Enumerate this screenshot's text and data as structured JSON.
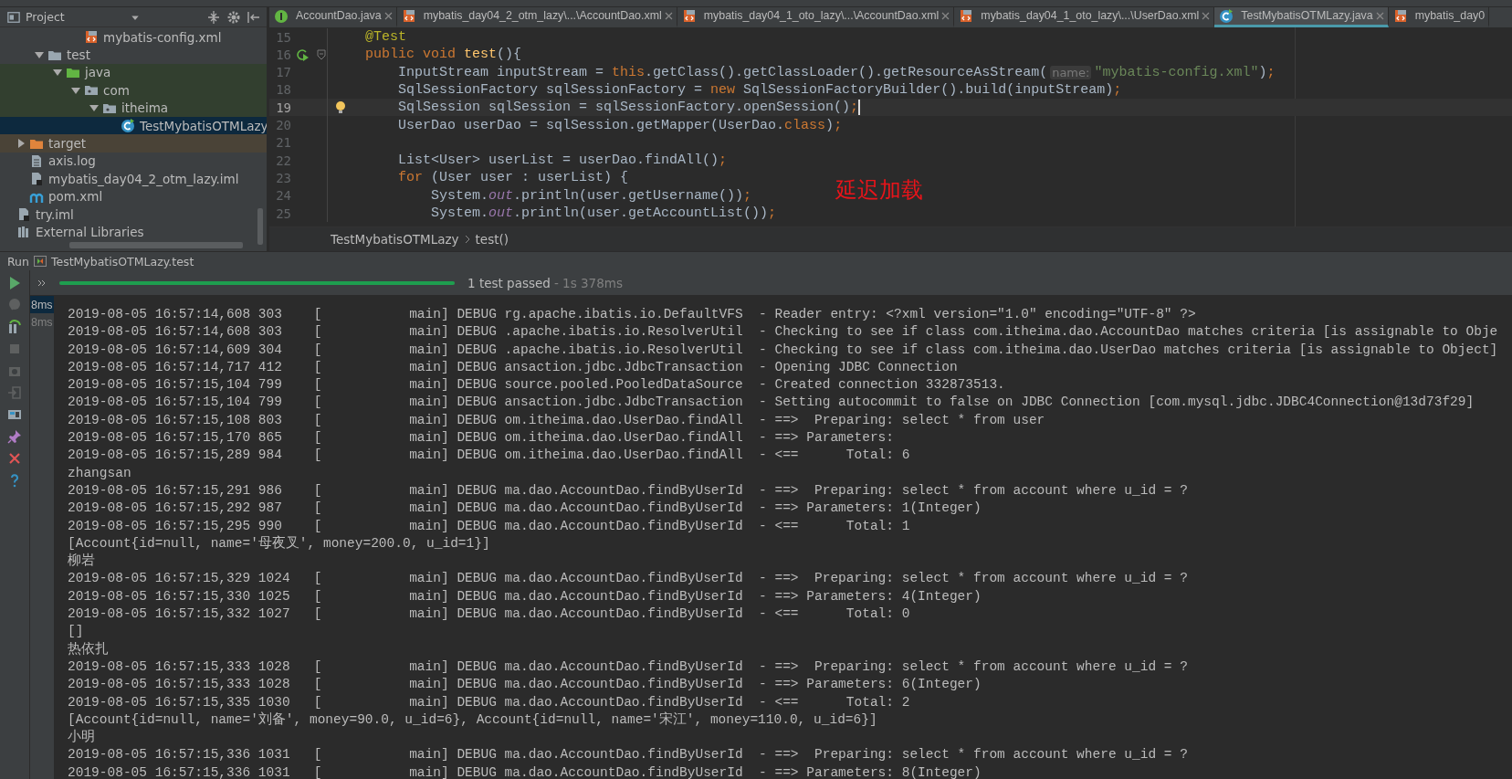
{
  "project_panel": {
    "title": "Project",
    "tree": [
      {
        "children": [
          {
            "children": [
              {
                "children": [
                  {
                    "children": [
                      {
                        "label": "mybatis-config.xml",
                        "kind": "xml",
                        "selected": false
                      }
                    ]
                  }
                ]
              },
              {
                "label": "test",
                "kind": "folder",
                "expanded": true,
                "selected": false,
                "children": [
                  {
                    "label": "java",
                    "kind": "test-root",
                    "expanded": true,
                    "selected": false,
                    "children": [
                      {
                        "label": "com",
                        "kind": "package",
                        "expanded": true,
                        "selected": false,
                        "children": [
                          {
                            "label": "itheima",
                            "kind": "package",
                            "expanded": true,
                            "selected": false,
                            "children": [
                              {
                                "label": "TestMybatisOTMLazy",
                                "kind": "test-class",
                                "selected": true
                              }
                            ]
                          }
                        ]
                      }
                    ]
                  }
                ]
              }
            ]
          },
          {
            "label": "target",
            "kind": "excluded",
            "expanded": false,
            "selected": false
          },
          {
            "label": "axis.log",
            "kind": "file",
            "selected": false
          },
          {
            "label": "mybatis_day04_2_otm_lazy.iml",
            "kind": "iml",
            "selected": false
          },
          {
            "label": "pom.xml",
            "kind": "maven",
            "selected": false
          }
        ]
      },
      {
        "label": "try.iml",
        "kind": "iml",
        "selected": false
      },
      {
        "label": "External Libraries",
        "kind": "libraries",
        "selected": false
      }
    ]
  },
  "editor": {
    "tabs": [
      {
        "label": "AccountDao.java",
        "kind": "interface",
        "selected": false,
        "closable": true
      },
      {
        "label": "mybatis_day04_2_otm_lazy\\...\\AccountDao.xml",
        "kind": "xml",
        "selected": false,
        "closable": true
      },
      {
        "label": "mybatis_day04_1_oto_lazy\\...\\AccountDao.xml",
        "kind": "xml",
        "selected": false,
        "closable": true
      },
      {
        "label": "mybatis_day04_1_oto_lazy\\...\\UserDao.xml",
        "kind": "xml",
        "selected": false,
        "closable": true
      },
      {
        "label": "TestMybatisOTMLazy.java",
        "kind": "test-class",
        "selected": true,
        "closable": true
      },
      {
        "label": "mybatis_day0",
        "kind": "xml",
        "selected": false
      }
    ],
    "lines": [
      {
        "number": "15",
        "kind": "plain",
        "current": false,
        "tokens": [
          {
            "kind": "annotation",
            "text": "    @Test"
          }
        ]
      },
      {
        "number": "16",
        "kind": "run",
        "current": false,
        "tokens": [
          {
            "kind": "keyword",
            "text": "    public void "
          },
          {
            "kind": "method",
            "text": "test"
          },
          {
            "kind": "plain",
            "text": "(){"
          }
        ]
      },
      {
        "number": "17",
        "kind": "plain",
        "current": false,
        "tokens": [
          {
            "kind": "plain",
            "text": "        InputStream inputStream = "
          },
          {
            "kind": "keyword",
            "text": "this"
          },
          {
            "kind": "plain",
            "text": ".getClass().getClassLoader().getResourceAsStream("
          },
          {
            "kind": "hint",
            "text": "name:"
          },
          {
            "kind": "string",
            "text": "\"mybatis-config.xml\""
          },
          {
            "kind": "plain",
            "text": ")"
          },
          {
            "kind": "keyword",
            "text": ";"
          }
        ]
      },
      {
        "number": "18",
        "kind": "plain",
        "current": false,
        "tokens": [
          {
            "kind": "plain",
            "text": "        SqlSessionFactory sqlSessionFactory = "
          },
          {
            "kind": "keyword",
            "text": "new"
          },
          {
            "kind": "plain",
            "text": " SqlSessionFactoryBuilder().build(inputStream)"
          },
          {
            "kind": "keyword",
            "text": ";"
          }
        ]
      },
      {
        "number": "19",
        "kind": "bulb",
        "current": true,
        "tokens": [
          {
            "kind": "plain",
            "text": "        SqlSession sqlSession = sqlSessionFactory.openSession()"
          },
          {
            "kind": "keyword",
            "text": ";"
          }
        ]
      },
      {
        "number": "20",
        "kind": "plain",
        "current": false,
        "tokens": [
          {
            "kind": "plain",
            "text": "        UserDao userDao = sqlSession.getMapper(UserDao."
          },
          {
            "kind": "keyword",
            "text": "class"
          },
          {
            "kind": "plain",
            "text": ")"
          },
          {
            "kind": "keyword",
            "text": ";"
          }
        ]
      },
      {
        "number": "21",
        "kind": "plain",
        "current": false
      },
      {
        "number": "22",
        "kind": "plain",
        "current": false,
        "tokens": [
          {
            "kind": "plain",
            "text": "        List<User> userList = userDao.findAll()"
          },
          {
            "kind": "keyword",
            "text": ";"
          }
        ]
      },
      {
        "number": "23",
        "kind": "plain",
        "current": false,
        "tokens": [
          {
            "kind": "keyword",
            "text": "        for"
          },
          {
            "kind": "plain",
            "text": " (User user : userList) {"
          }
        ]
      },
      {
        "number": "24",
        "kind": "plain",
        "current": false,
        "tokens": [
          {
            "kind": "plain",
            "text": "            System."
          },
          {
            "kind": "static",
            "text": "out"
          },
          {
            "kind": "plain",
            "text": ".println(user.getUsername())"
          },
          {
            "kind": "keyword",
            "text": ";"
          }
        ]
      },
      {
        "number": "25",
        "kind": "plain",
        "current": false,
        "tokens": [
          {
            "kind": "plain",
            "text": "            System."
          },
          {
            "kind": "static",
            "text": "out"
          },
          {
            "kind": "plain",
            "text": ".println(user.getAccountList())"
          },
          {
            "kind": "keyword",
            "text": ";"
          }
        ]
      }
    ],
    "annotation": "延迟加载",
    "breadcrumb": [
      "TestMybatisOTMLazy",
      "test()"
    ]
  },
  "run_panel": {
    "label": "Run",
    "config": "TestMybatisOTMLazy.test",
    "progress": {
      "level": 1
    },
    "status": "1 test passed",
    "duration": "- 1s 378ms",
    "tests": [
      {
        "duration": "8ms",
        "selected": true
      },
      {
        "duration": "8ms",
        "selected": false
      }
    ],
    "console": [
      {
        "kind": "log",
        "time": "2019-08-05 16:57:14,608 303",
        "thread": "[           main]",
        "level": "DEBUG",
        "logger": "rg.apache.ibatis.io.DefaultVFS",
        "message": "- Reader entry: <?xml version=\"1.0\" encoding=\"UTF-8\" ?>"
      },
      {
        "kind": "log",
        "time": "2019-08-05 16:57:14,608 303",
        "thread": "[           main]",
        "level": "DEBUG",
        "logger": ".apache.ibatis.io.ResolverUtil",
        "message": "- Checking to see if class com.itheima.dao.AccountDao matches criteria [is assignable to Obje"
      },
      {
        "kind": "log",
        "time": "2019-08-05 16:57:14,609 304",
        "thread": "[           main]",
        "level": "DEBUG",
        "logger": ".apache.ibatis.io.ResolverUtil",
        "message": "- Checking to see if class com.itheima.dao.UserDao matches criteria [is assignable to Object]"
      },
      {
        "kind": "log",
        "time": "2019-08-05 16:57:14,717 412",
        "thread": "[           main]",
        "level": "DEBUG",
        "logger": "ansaction.jdbc.JdbcTransaction",
        "message": "- Opening JDBC Connection"
      },
      {
        "kind": "log",
        "time": "2019-08-05 16:57:15,104 799",
        "thread": "[           main]",
        "level": "DEBUG",
        "logger": "source.pooled.PooledDataSource",
        "message": "- Created connection 332873513."
      },
      {
        "kind": "log",
        "time": "2019-08-05 16:57:15,104 799",
        "thread": "[           main]",
        "level": "DEBUG",
        "logger": "ansaction.jdbc.JdbcTransaction",
        "message": "- Setting autocommit to false on JDBC Connection [com.mysql.jdbc.JDBC4Connection@13d73f29]"
      },
      {
        "kind": "log",
        "time": "2019-08-05 16:57:15,108 803",
        "thread": "[           main]",
        "level": "DEBUG",
        "logger": "om.itheima.dao.UserDao.findAll",
        "message": "- ==>  Preparing: select * from user"
      },
      {
        "kind": "log",
        "time": "2019-08-05 16:57:15,170 865",
        "thread": "[           main]",
        "level": "DEBUG",
        "logger": "om.itheima.dao.UserDao.findAll",
        "message": "- ==> Parameters:"
      },
      {
        "kind": "log",
        "time": "2019-08-05 16:57:15,289 984",
        "thread": "[           main]",
        "level": "DEBUG",
        "logger": "om.itheima.dao.UserDao.findAll",
        "message": "- <==      Total: 6"
      },
      {
        "kind": "out",
        "text": "zhangsan"
      },
      {
        "kind": "log",
        "time": "2019-08-05 16:57:15,291 986",
        "thread": "[           main]",
        "level": "DEBUG",
        "logger": "ma.dao.AccountDao.findByUserId",
        "message": "- ==>  Preparing: select * from account where u_id = ?"
      },
      {
        "kind": "log",
        "time": "2019-08-05 16:57:15,292 987",
        "thread": "[           main]",
        "level": "DEBUG",
        "logger": "ma.dao.AccountDao.findByUserId",
        "message": "- ==> Parameters: 1(Integer)"
      },
      {
        "kind": "log",
        "time": "2019-08-05 16:57:15,295 990",
        "thread": "[           main]",
        "level": "DEBUG",
        "logger": "ma.dao.AccountDao.findByUserId",
        "message": "- <==      Total: 1"
      },
      {
        "kind": "out",
        "text": "[Account{id=null, name='母夜叉', money=200.0, u_id=1}]"
      },
      {
        "kind": "out",
        "text": "柳岩"
      },
      {
        "kind": "log",
        "time": "2019-08-05 16:57:15,329 1024",
        "thread": "[           main]",
        "level": "DEBUG",
        "logger": "ma.dao.AccountDao.findByUserId",
        "message": "- ==>  Preparing: select * from account where u_id = ?"
      },
      {
        "kind": "log",
        "time": "2019-08-05 16:57:15,330 1025",
        "thread": "[           main]",
        "level": "DEBUG",
        "logger": "ma.dao.AccountDao.findByUserId",
        "message": "- ==> Parameters: 4(Integer)"
      },
      {
        "kind": "log",
        "time": "2019-08-05 16:57:15,332 1027",
        "thread": "[           main]",
        "level": "DEBUG",
        "logger": "ma.dao.AccountDao.findByUserId",
        "message": "- <==      Total: 0"
      },
      {
        "kind": "out",
        "text": "[]"
      },
      {
        "kind": "out",
        "text": "热依扎"
      },
      {
        "kind": "log",
        "time": "2019-08-05 16:57:15,333 1028",
        "thread": "[           main]",
        "level": "DEBUG",
        "logger": "ma.dao.AccountDao.findByUserId",
        "message": "- ==>  Preparing: select * from account where u_id = ?"
      },
      {
        "kind": "log",
        "time": "2019-08-05 16:57:15,333 1028",
        "thread": "[           main]",
        "level": "DEBUG",
        "logger": "ma.dao.AccountDao.findByUserId",
        "message": "- ==> Parameters: 6(Integer)"
      },
      {
        "kind": "log",
        "time": "2019-08-05 16:57:15,335 1030",
        "thread": "[           main]",
        "level": "DEBUG",
        "logger": "ma.dao.AccountDao.findByUserId",
        "message": "- <==      Total: 2"
      },
      {
        "kind": "out",
        "text": "[Account{id=null, name='刘备', money=90.0, u_id=6}, Account{id=null, name='宋江', money=110.0, u_id=6}]"
      },
      {
        "kind": "out",
        "text": "小明"
      },
      {
        "kind": "log",
        "time": "2019-08-05 16:57:15,336 1031",
        "thread": "[           main]",
        "level": "DEBUG",
        "logger": "ma.dao.AccountDao.findByUserId",
        "message": "- ==>  Preparing: select * from account where u_id = ?"
      },
      {
        "kind": "log",
        "time": "2019-08-05 16:57:15,336 1031",
        "thread": "[           main]",
        "level": "DEBUG",
        "logger": "ma.dao.AccountDao.findByUserId",
        "message": "- ==> Parameters: 8(Integer)"
      }
    ]
  }
}
